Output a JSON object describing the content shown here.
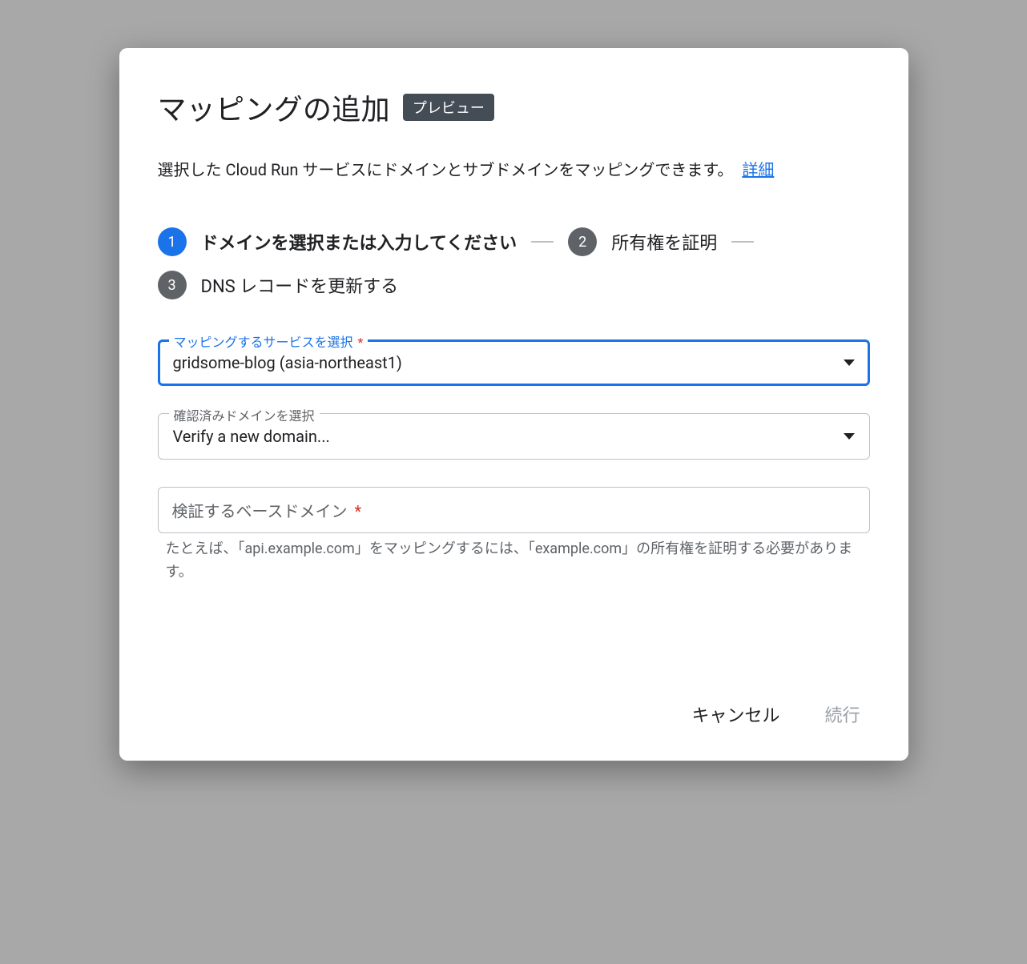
{
  "dialog": {
    "title": "マッピングの追加",
    "preview_badge": "プレビュー",
    "description": "選択した Cloud Run サービスにドメインとサブドメインをマッピングできます。",
    "detail_link": "詳細"
  },
  "stepper": {
    "steps": [
      {
        "number": "1",
        "label": "ドメインを選択または入力してください",
        "active": true
      },
      {
        "number": "2",
        "label": "所有権を証明",
        "active": false
      },
      {
        "number": "3",
        "label": "DNS レコードを更新する",
        "active": false
      }
    ]
  },
  "fields": {
    "service_select": {
      "label": "マッピングするサービスを選択",
      "required_mark": "*",
      "value": "gridsome-blog (asia-northeast1)"
    },
    "domain_select": {
      "label": "確認済みドメインを選択",
      "value": "Verify a new domain..."
    },
    "base_domain_input": {
      "placeholder": "検証するベースドメイン",
      "required_mark": "*",
      "value": "",
      "helper": "たとえば、「api.example.com」をマッピングするには、「example.com」の所有権を証明する必要があります。"
    }
  },
  "actions": {
    "cancel": "キャンセル",
    "continue": "続行"
  }
}
